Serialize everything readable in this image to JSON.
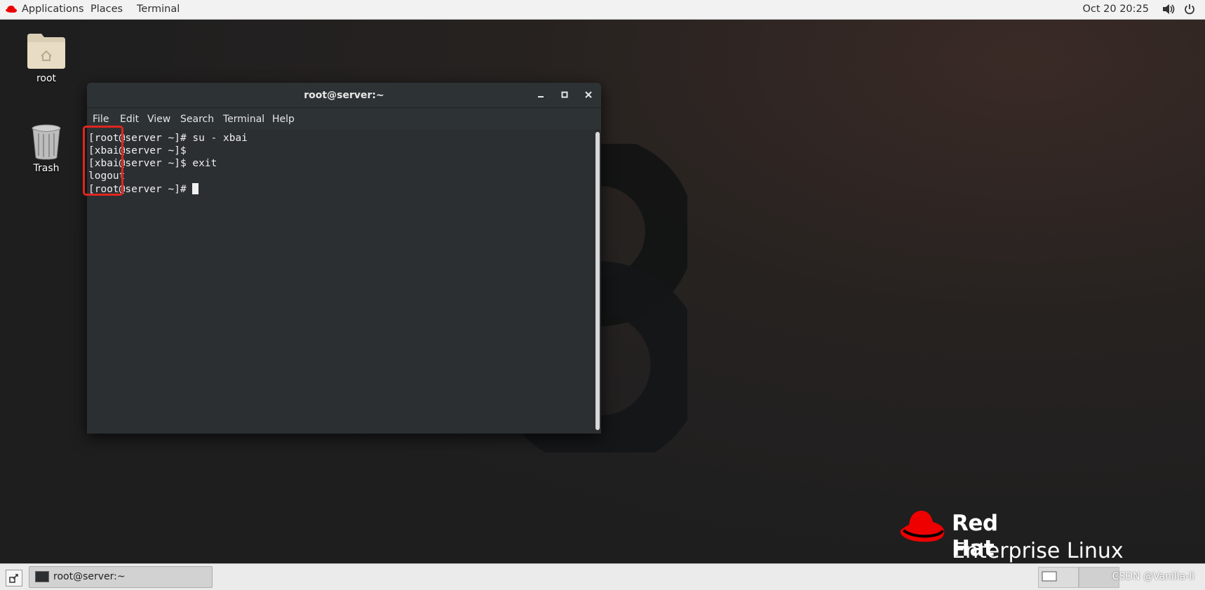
{
  "topbar": {
    "menus": [
      "Applications",
      "Places",
      "Terminal"
    ],
    "clock": "Oct 20  20:25",
    "icons": [
      "redhat-icon",
      "volume-icon",
      "power-icon"
    ]
  },
  "desktop": {
    "icons": [
      {
        "label": "root",
        "icon": "home-folder-icon"
      },
      {
        "label": "Trash",
        "icon": "trash-icon"
      }
    ]
  },
  "terminal": {
    "title": "root@server:~",
    "menu": [
      "File",
      "Edit",
      "View",
      "Search",
      "Terminal",
      "Help"
    ],
    "lines": [
      "[root@server ~]# su - xbai",
      "[xbai@server ~]$",
      "[xbai@server ~]$ exit",
      "logout",
      "[root@server ~]# "
    ],
    "highlight_color": "#e1261f"
  },
  "branding": {
    "line1": "Red Hat",
    "line2": "Enterprise Linux",
    "color": "#ee0000"
  },
  "taskbar": {
    "window_label": "root@server:~",
    "watermark": "CSDN @Vanilla-li"
  }
}
